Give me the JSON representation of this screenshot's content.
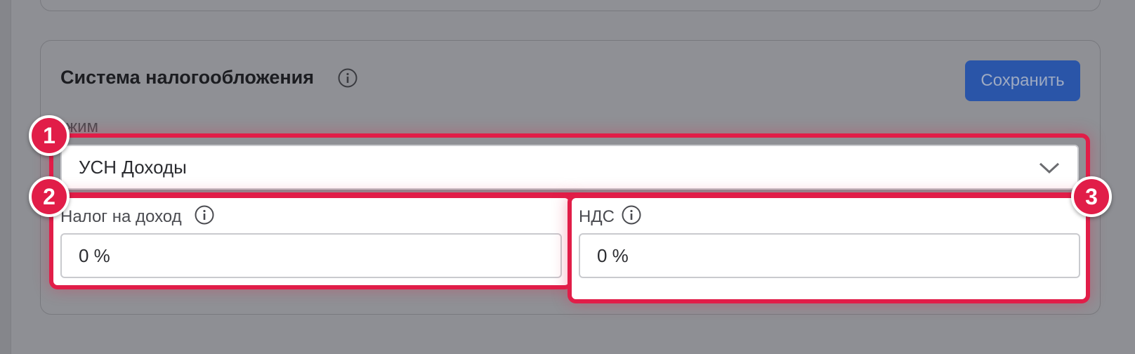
{
  "section": {
    "title": "Система налогообложения",
    "save_label": "Сохранить"
  },
  "mode": {
    "label": "Режим",
    "value": "УСН Доходы"
  },
  "income_tax": {
    "label": "Налог на доход",
    "value": "0 %"
  },
  "vat": {
    "label": "НДС",
    "value": "0 %"
  },
  "badges": [
    "1",
    "2",
    "3"
  ],
  "colors": {
    "highlight": "#e11d48",
    "button": "#2a55a8"
  }
}
